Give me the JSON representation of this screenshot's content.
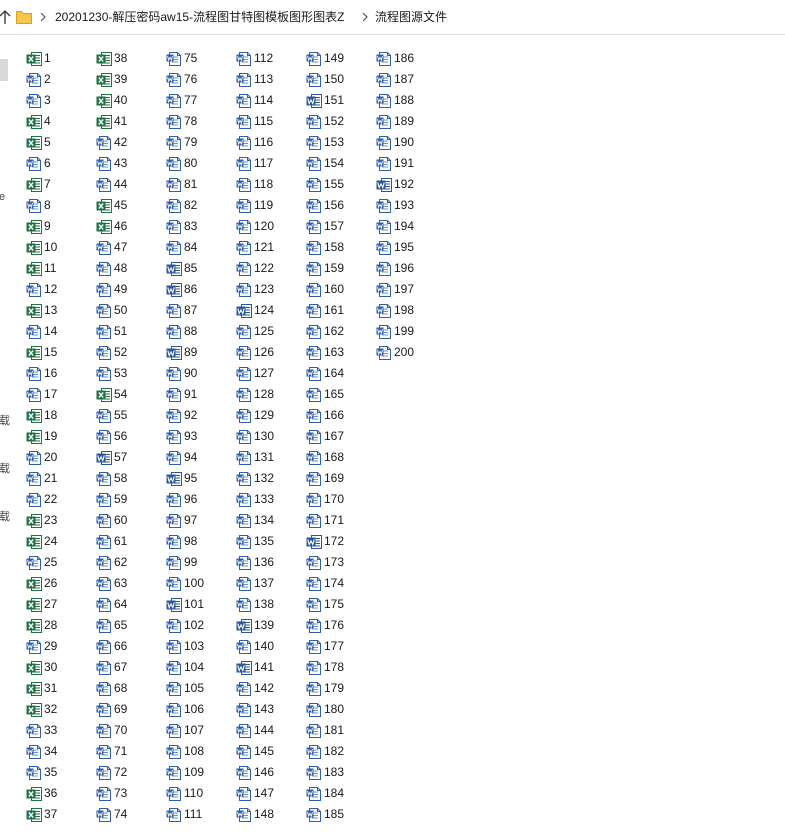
{
  "breadcrumb": {
    "path": [
      "20201230-解压密码aw15-流程图甘特图模板图形图表Z",
      "流程图源文件"
    ]
  },
  "left_pane": {
    "visible_fragments": [
      "e",
      "载",
      "载",
      "载"
    ]
  },
  "colors": {
    "excel_green": "#1f7244",
    "word_blue": "#2b579a",
    "wps_doc_border": "#2f5fa8",
    "folder_yellow": "#f3c64b"
  },
  "icon_types": {
    "xlsx": "excel-file-icon",
    "docx": "word-file-icon",
    "doc": "doc-file-icon"
  },
  "files": [
    {
      "name": "1",
      "type": "xlsx"
    },
    {
      "name": "2",
      "type": "doc"
    },
    {
      "name": "3",
      "type": "doc"
    },
    {
      "name": "4",
      "type": "xlsx"
    },
    {
      "name": "5",
      "type": "xlsx"
    },
    {
      "name": "6",
      "type": "doc"
    },
    {
      "name": "7",
      "type": "xlsx"
    },
    {
      "name": "8",
      "type": "doc"
    },
    {
      "name": "9",
      "type": "xlsx"
    },
    {
      "name": "10",
      "type": "xlsx"
    },
    {
      "name": "11",
      "type": "xlsx"
    },
    {
      "name": "12",
      "type": "doc"
    },
    {
      "name": "13",
      "type": "xlsx"
    },
    {
      "name": "14",
      "type": "doc"
    },
    {
      "name": "15",
      "type": "xlsx"
    },
    {
      "name": "16",
      "type": "doc"
    },
    {
      "name": "17",
      "type": "doc"
    },
    {
      "name": "18",
      "type": "xlsx"
    },
    {
      "name": "19",
      "type": "xlsx"
    },
    {
      "name": "20",
      "type": "doc"
    },
    {
      "name": "21",
      "type": "doc"
    },
    {
      "name": "22",
      "type": "doc"
    },
    {
      "name": "23",
      "type": "xlsx"
    },
    {
      "name": "24",
      "type": "xlsx"
    },
    {
      "name": "25",
      "type": "doc"
    },
    {
      "name": "26",
      "type": "xlsx"
    },
    {
      "name": "27",
      "type": "xlsx"
    },
    {
      "name": "28",
      "type": "xlsx"
    },
    {
      "name": "29",
      "type": "doc"
    },
    {
      "name": "30",
      "type": "xlsx"
    },
    {
      "name": "31",
      "type": "xlsx"
    },
    {
      "name": "32",
      "type": "xlsx"
    },
    {
      "name": "33",
      "type": "doc"
    },
    {
      "name": "34",
      "type": "doc"
    },
    {
      "name": "35",
      "type": "doc"
    },
    {
      "name": "36",
      "type": "xlsx"
    },
    {
      "name": "37",
      "type": "xlsx"
    },
    {
      "name": "38",
      "type": "xlsx"
    },
    {
      "name": "39",
      "type": "xlsx"
    },
    {
      "name": "40",
      "type": "xlsx"
    },
    {
      "name": "41",
      "type": "xlsx"
    },
    {
      "name": "42",
      "type": "doc"
    },
    {
      "name": "43",
      "type": "doc"
    },
    {
      "name": "44",
      "type": "doc"
    },
    {
      "name": "45",
      "type": "xlsx"
    },
    {
      "name": "46",
      "type": "xlsx"
    },
    {
      "name": "47",
      "type": "doc"
    },
    {
      "name": "48",
      "type": "doc"
    },
    {
      "name": "49",
      "type": "doc"
    },
    {
      "name": "50",
      "type": "doc"
    },
    {
      "name": "51",
      "type": "doc"
    },
    {
      "name": "52",
      "type": "doc"
    },
    {
      "name": "53",
      "type": "doc"
    },
    {
      "name": "54",
      "type": "xlsx"
    },
    {
      "name": "55",
      "type": "doc"
    },
    {
      "name": "56",
      "type": "doc"
    },
    {
      "name": "57",
      "type": "docx"
    },
    {
      "name": "58",
      "type": "doc"
    },
    {
      "name": "59",
      "type": "doc"
    },
    {
      "name": "60",
      "type": "doc"
    },
    {
      "name": "61",
      "type": "doc"
    },
    {
      "name": "62",
      "type": "doc"
    },
    {
      "name": "63",
      "type": "doc"
    },
    {
      "name": "64",
      "type": "doc"
    },
    {
      "name": "65",
      "type": "doc"
    },
    {
      "name": "66",
      "type": "doc"
    },
    {
      "name": "67",
      "type": "doc"
    },
    {
      "name": "68",
      "type": "doc"
    },
    {
      "name": "69",
      "type": "doc"
    },
    {
      "name": "70",
      "type": "doc"
    },
    {
      "name": "71",
      "type": "doc"
    },
    {
      "name": "72",
      "type": "doc"
    },
    {
      "name": "73",
      "type": "doc"
    },
    {
      "name": "74",
      "type": "doc"
    },
    {
      "name": "75",
      "type": "doc"
    },
    {
      "name": "76",
      "type": "doc"
    },
    {
      "name": "77",
      "type": "doc"
    },
    {
      "name": "78",
      "type": "doc"
    },
    {
      "name": "79",
      "type": "doc"
    },
    {
      "name": "80",
      "type": "doc"
    },
    {
      "name": "81",
      "type": "doc"
    },
    {
      "name": "82",
      "type": "doc"
    },
    {
      "name": "83",
      "type": "doc"
    },
    {
      "name": "84",
      "type": "doc"
    },
    {
      "name": "85",
      "type": "docx"
    },
    {
      "name": "86",
      "type": "docx"
    },
    {
      "name": "87",
      "type": "doc"
    },
    {
      "name": "88",
      "type": "doc"
    },
    {
      "name": "89",
      "type": "docx"
    },
    {
      "name": "90",
      "type": "doc"
    },
    {
      "name": "91",
      "type": "doc"
    },
    {
      "name": "92",
      "type": "doc"
    },
    {
      "name": "93",
      "type": "doc"
    },
    {
      "name": "94",
      "type": "doc"
    },
    {
      "name": "95",
      "type": "docx"
    },
    {
      "name": "96",
      "type": "doc"
    },
    {
      "name": "97",
      "type": "doc"
    },
    {
      "name": "98",
      "type": "doc"
    },
    {
      "name": "99",
      "type": "doc"
    },
    {
      "name": "100",
      "type": "doc"
    },
    {
      "name": "101",
      "type": "docx"
    },
    {
      "name": "102",
      "type": "doc"
    },
    {
      "name": "103",
      "type": "doc"
    },
    {
      "name": "104",
      "type": "doc"
    },
    {
      "name": "105",
      "type": "doc"
    },
    {
      "name": "106",
      "type": "doc"
    },
    {
      "name": "107",
      "type": "doc"
    },
    {
      "name": "108",
      "type": "doc"
    },
    {
      "name": "109",
      "type": "doc"
    },
    {
      "name": "110",
      "type": "doc"
    },
    {
      "name": "111",
      "type": "doc"
    },
    {
      "name": "112",
      "type": "doc"
    },
    {
      "name": "113",
      "type": "doc"
    },
    {
      "name": "114",
      "type": "doc"
    },
    {
      "name": "115",
      "type": "doc"
    },
    {
      "name": "116",
      "type": "doc"
    },
    {
      "name": "117",
      "type": "doc"
    },
    {
      "name": "118",
      "type": "doc"
    },
    {
      "name": "119",
      "type": "doc"
    },
    {
      "name": "120",
      "type": "doc"
    },
    {
      "name": "121",
      "type": "doc"
    },
    {
      "name": "122",
      "type": "doc"
    },
    {
      "name": "123",
      "type": "doc"
    },
    {
      "name": "124",
      "type": "docx"
    },
    {
      "name": "125",
      "type": "doc"
    },
    {
      "name": "126",
      "type": "doc"
    },
    {
      "name": "127",
      "type": "doc"
    },
    {
      "name": "128",
      "type": "doc"
    },
    {
      "name": "129",
      "type": "doc"
    },
    {
      "name": "130",
      "type": "doc"
    },
    {
      "name": "131",
      "type": "doc"
    },
    {
      "name": "132",
      "type": "doc"
    },
    {
      "name": "133",
      "type": "doc"
    },
    {
      "name": "134",
      "type": "doc"
    },
    {
      "name": "135",
      "type": "doc"
    },
    {
      "name": "136",
      "type": "doc"
    },
    {
      "name": "137",
      "type": "doc"
    },
    {
      "name": "138",
      "type": "doc"
    },
    {
      "name": "139",
      "type": "docx"
    },
    {
      "name": "140",
      "type": "doc"
    },
    {
      "name": "141",
      "type": "docx"
    },
    {
      "name": "142",
      "type": "doc"
    },
    {
      "name": "143",
      "type": "doc"
    },
    {
      "name": "144",
      "type": "doc"
    },
    {
      "name": "145",
      "type": "doc"
    },
    {
      "name": "146",
      "type": "doc"
    },
    {
      "name": "147",
      "type": "doc"
    },
    {
      "name": "148",
      "type": "doc"
    },
    {
      "name": "149",
      "type": "doc"
    },
    {
      "name": "150",
      "type": "doc"
    },
    {
      "name": "151",
      "type": "docx"
    },
    {
      "name": "152",
      "type": "doc"
    },
    {
      "name": "153",
      "type": "doc"
    },
    {
      "name": "154",
      "type": "doc"
    },
    {
      "name": "155",
      "type": "doc"
    },
    {
      "name": "156",
      "type": "doc"
    },
    {
      "name": "157",
      "type": "doc"
    },
    {
      "name": "158",
      "type": "doc"
    },
    {
      "name": "159",
      "type": "doc"
    },
    {
      "name": "160",
      "type": "doc"
    },
    {
      "name": "161",
      "type": "doc"
    },
    {
      "name": "162",
      "type": "doc"
    },
    {
      "name": "163",
      "type": "doc"
    },
    {
      "name": "164",
      "type": "doc"
    },
    {
      "name": "165",
      "type": "doc"
    },
    {
      "name": "166",
      "type": "doc"
    },
    {
      "name": "167",
      "type": "doc"
    },
    {
      "name": "168",
      "type": "doc"
    },
    {
      "name": "169",
      "type": "doc"
    },
    {
      "name": "170",
      "type": "doc"
    },
    {
      "name": "171",
      "type": "doc"
    },
    {
      "name": "172",
      "type": "docx"
    },
    {
      "name": "173",
      "type": "doc"
    },
    {
      "name": "174",
      "type": "doc"
    },
    {
      "name": "175",
      "type": "doc"
    },
    {
      "name": "176",
      "type": "doc"
    },
    {
      "name": "177",
      "type": "doc"
    },
    {
      "name": "178",
      "type": "doc"
    },
    {
      "name": "179",
      "type": "doc"
    },
    {
      "name": "180",
      "type": "doc"
    },
    {
      "name": "181",
      "type": "doc"
    },
    {
      "name": "182",
      "type": "doc"
    },
    {
      "name": "183",
      "type": "doc"
    },
    {
      "name": "184",
      "type": "doc"
    },
    {
      "name": "185",
      "type": "doc"
    },
    {
      "name": "186",
      "type": "doc"
    },
    {
      "name": "187",
      "type": "doc"
    },
    {
      "name": "188",
      "type": "doc"
    },
    {
      "name": "189",
      "type": "doc"
    },
    {
      "name": "190",
      "type": "doc"
    },
    {
      "name": "191",
      "type": "doc"
    },
    {
      "name": "192",
      "type": "docx"
    },
    {
      "name": "193",
      "type": "doc"
    },
    {
      "name": "194",
      "type": "doc"
    },
    {
      "name": "195",
      "type": "doc"
    },
    {
      "name": "196",
      "type": "doc"
    },
    {
      "name": "197",
      "type": "doc"
    },
    {
      "name": "198",
      "type": "doc"
    },
    {
      "name": "199",
      "type": "doc"
    },
    {
      "name": "200",
      "type": "doc"
    }
  ]
}
